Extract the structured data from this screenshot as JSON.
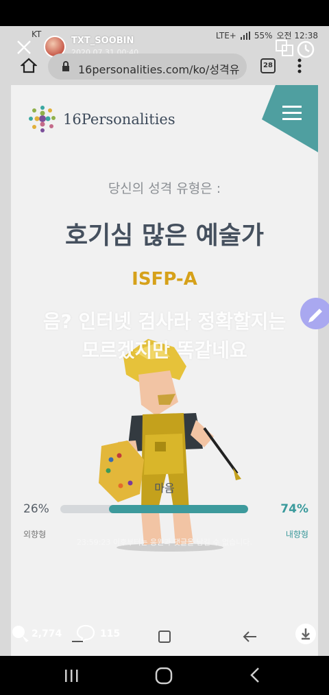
{
  "status_bar": {
    "carrier": "KT",
    "battery": "55%",
    "time": "오전 12:38",
    "network": "LTE+"
  },
  "story": {
    "username": "TXT_SOOBIN",
    "timestamp": "2020.07.31 00:40",
    "caption_line1": "음? 인터넷 검사라 정확할지는",
    "caption_line2": "모르겠지만 똑같네요",
    "notice": "23:59:23 이후부터는 응원과 댓글을 남길 수 없습니다.",
    "likes": "2,774",
    "comments": "115"
  },
  "browser": {
    "url": "16personalities.com/ko/성격유",
    "tab_count": "28"
  },
  "site": {
    "logo_text": "16Personalities",
    "subtitle": "당신의 성격 유형은 :",
    "type_name": "호기심 많은 예술가",
    "type_code": "ISFP-A",
    "trait": {
      "title": "마음",
      "left_pct": "26%",
      "right_pct": "74%",
      "left_label": "외향형",
      "right_label": "내향형",
      "fill_fraction": 0.74
    }
  },
  "colors": {
    "accent_teal": "#3d9a9c",
    "gold": "#d6a11a",
    "title_slate": "#45505e"
  },
  "icons": [
    "close-icon",
    "translate-icon",
    "history-icon",
    "home-icon",
    "lock-icon",
    "tabs-icon",
    "more-icon",
    "menu-icon",
    "edit-icon",
    "like-icon",
    "comment-icon",
    "download-icon"
  ]
}
